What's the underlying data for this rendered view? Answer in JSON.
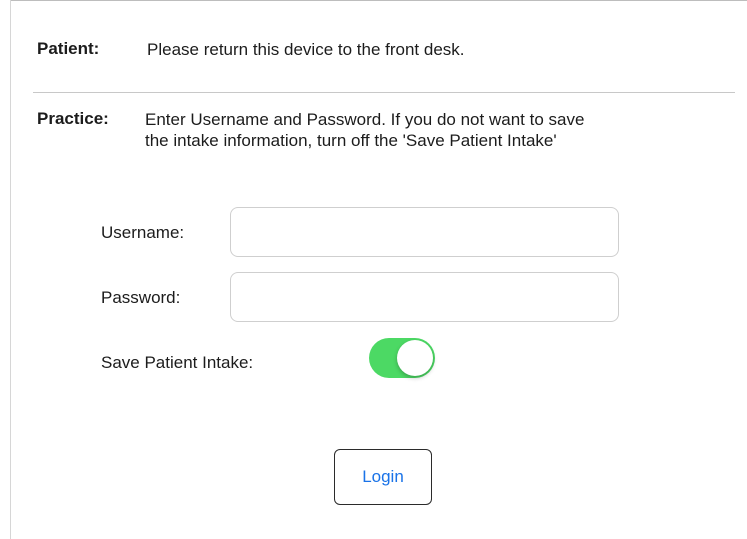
{
  "patient": {
    "label": "Patient:",
    "text": "Please return this device to the front desk."
  },
  "practice": {
    "label": "Practice:",
    "text_line1": "Enter Username and Password.  If you do not want to save",
    "text_line2": "the intake information, turn off the 'Save Patient Intake'"
  },
  "form": {
    "username_label": "Username:",
    "username_value": "",
    "password_label": "Password:",
    "password_value": "",
    "save_intake_label": "Save Patient Intake:",
    "save_intake_on": true,
    "login_label": "Login"
  },
  "colors": {
    "toggle_on": "#4cd964",
    "button_text": "#1a73e8"
  }
}
